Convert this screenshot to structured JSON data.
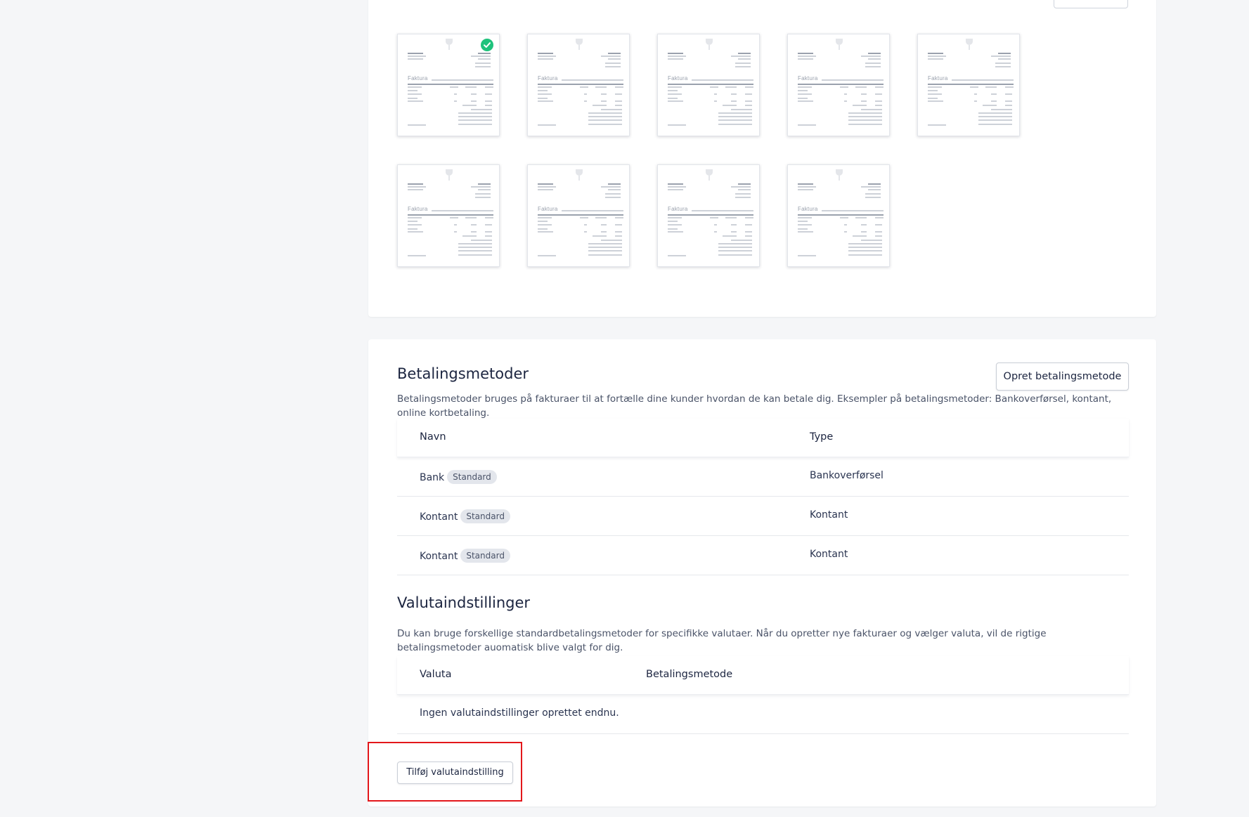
{
  "templates": {
    "thumbnail_label": "Faktura",
    "selected_index": 0,
    "count": 9
  },
  "payment_methods": {
    "title": "Betalingsmetoder",
    "description": "Betalingsmetoder bruges på fakturaer til at fortælle dine kunder hvordan de kan betale dig. Eksempler på betalingsmetoder: Bankoverførsel, kontant, online kortbetaling.",
    "create_button": "Opret betalingsmetode",
    "columns": [
      "Navn",
      "Type"
    ],
    "rows": [
      {
        "name": "Bank",
        "badge": "Standard",
        "type": "Bankoverførsel"
      },
      {
        "name": "Kontant",
        "badge": "Standard",
        "type": "Kontant"
      },
      {
        "name": "Kontant",
        "badge": "Standard",
        "type": "Kontant"
      }
    ]
  },
  "currency_settings": {
    "title": "Valutaindstillinger",
    "description": "Du kan bruge forskellige standardbetalingsmetoder for specifikke valutaer. Når du opretter nye fakturaer og vælger valuta, vil de rigtige betalingsmetoder auomatisk blive valgt for dig.",
    "columns": [
      "Valuta",
      "Betalingsmetode"
    ],
    "empty_text": "Ingen valutaindstillinger oprettet endnu.",
    "add_button": "Tilføj valutaindstilling"
  },
  "colors": {
    "accent_check": "#1fc27c",
    "highlight": "#e3171b",
    "badge_bg": "#e3e6ec"
  }
}
